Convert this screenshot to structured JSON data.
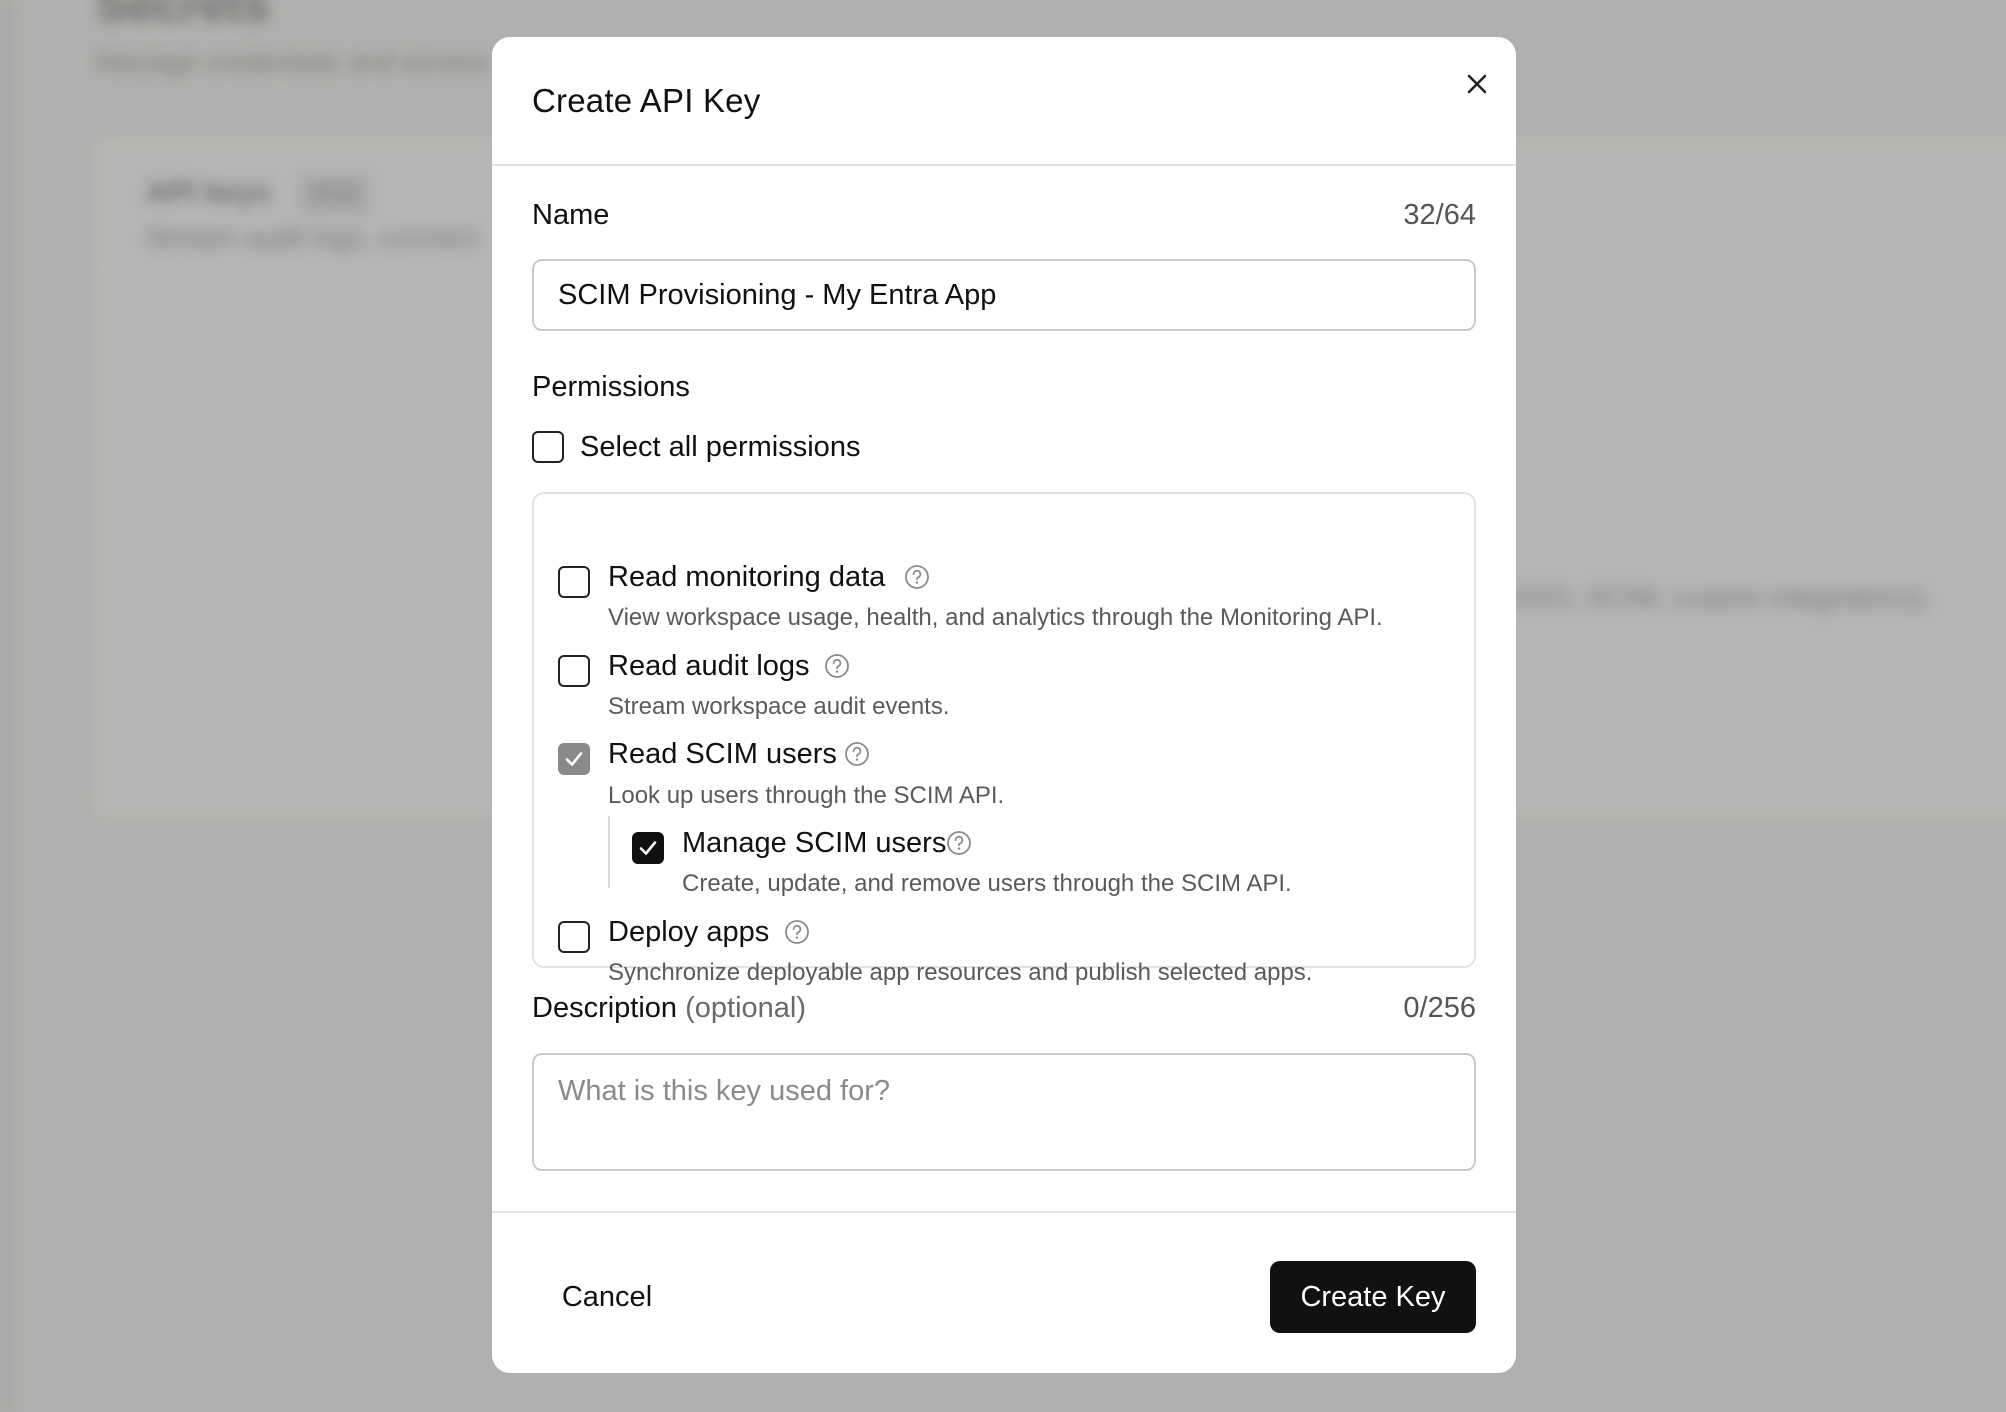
{
  "background": {
    "title": "Secrets",
    "subtitle": "Manage credentials and access",
    "card_title": "API keys",
    "card_badge": "0/10",
    "card_desc": "Stream audit logs, connect",
    "card_line": "SSO, SCIM, custom integrations)."
  },
  "modal": {
    "title": "Create API Key",
    "close_icon": "close-icon",
    "name": {
      "label": "Name",
      "counter": "32/64",
      "value": "SCIM Provisioning - My Entra App"
    },
    "permissions": {
      "label": "Permissions",
      "select_all_label": "Select all permissions",
      "select_all_checked": false,
      "items": [
        {
          "title": "Read monitoring data",
          "desc": "View workspace usage, health, and analytics through the Monitoring API.",
          "state": "unchecked"
        },
        {
          "title": "Read audit logs",
          "desc": "Stream workspace audit events.",
          "state": "unchecked"
        },
        {
          "title": "Read SCIM users",
          "desc": "Look up users through the SCIM API.",
          "state": "partial"
        },
        {
          "title": "Manage SCIM users",
          "desc": "Create, update, and remove users through the SCIM API.",
          "state": "checked"
        },
        {
          "title": "Deploy apps",
          "desc": "Synchronize deployable app resources and publish selected apps.",
          "state": "unchecked"
        }
      ]
    },
    "description": {
      "label": "Description",
      "optional": "(optional)",
      "counter": "0/256",
      "placeholder": "What is this key used for?",
      "value": ""
    },
    "footer": {
      "cancel_label": "Cancel",
      "create_label": "Create Key"
    },
    "colors": {
      "primary": "#111111",
      "partial_check": "#8a8a8a",
      "border": "#c9c9c9",
      "overlay": "#b1b0ae"
    }
  }
}
